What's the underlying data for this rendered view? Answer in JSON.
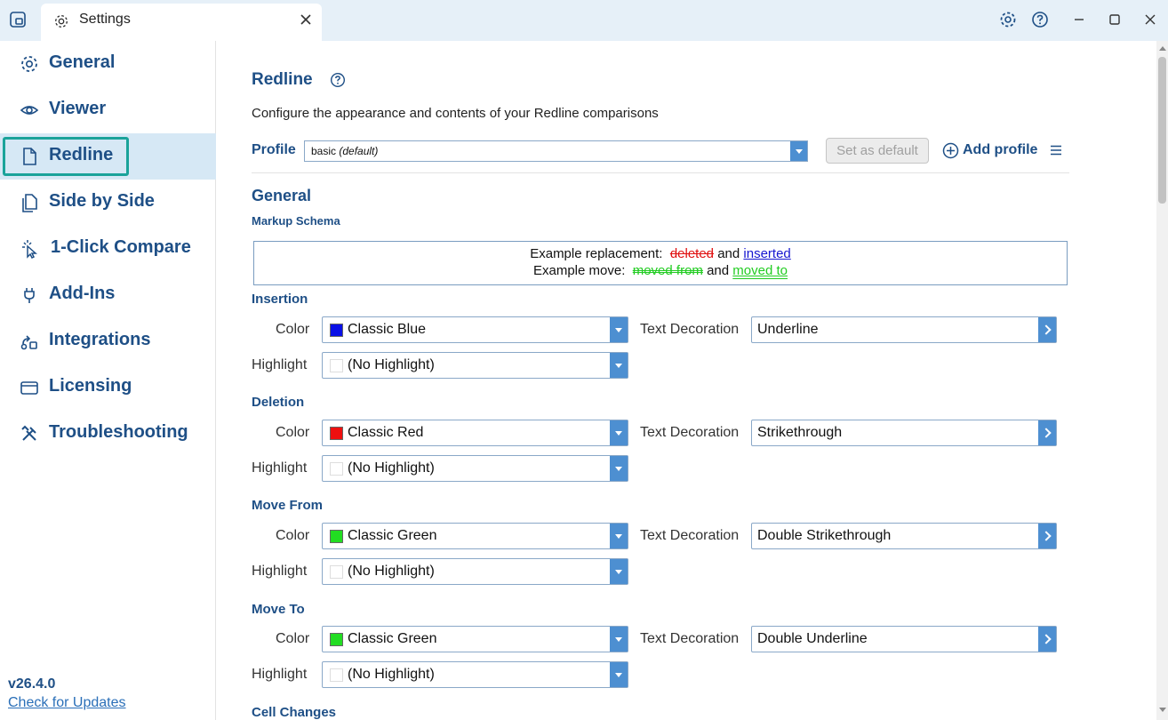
{
  "window": {
    "tab_title": "Settings",
    "controls": [
      "settings-icon",
      "help-icon",
      "minimize-icon",
      "maximize-icon",
      "close-icon"
    ]
  },
  "sidebar": {
    "items": [
      {
        "label": "General",
        "icon": "gear-icon"
      },
      {
        "label": "Viewer",
        "icon": "eye-icon"
      },
      {
        "label": "Redline",
        "icon": "document-icon",
        "active": true
      },
      {
        "label": "Side by Side",
        "icon": "documents-icon"
      },
      {
        "label": "1-Click Compare",
        "icon": "pointer-click-icon"
      },
      {
        "label": "Add-Ins",
        "icon": "plug-icon"
      },
      {
        "label": "Integrations",
        "icon": "integrations-icon"
      },
      {
        "label": "Licensing",
        "icon": "card-icon"
      },
      {
        "label": "Troubleshooting",
        "icon": "tools-icon"
      }
    ],
    "version": "v26.4.0",
    "check_updates": "Check for Updates"
  },
  "main": {
    "title": "Redline",
    "description": "Configure the appearance and contents of your Redline comparisons",
    "profile": {
      "label": "Profile",
      "value": "basic",
      "value_suffix": "(default)",
      "set_default": "Set as default",
      "add_profile": "Add profile"
    },
    "general_title": "General",
    "markup_schema": {
      "title": "Markup Schema",
      "replacement_prefix": "Example replacement:",
      "deleted": "deleted",
      "and1": "and",
      "inserted": "inserted",
      "move_prefix": "Example move:",
      "moved_from": "moved from",
      "and2": "and",
      "moved_to": "moved to"
    },
    "labels": {
      "color": "Color",
      "highlight": "Highlight",
      "text_decoration": "Text Decoration"
    },
    "groups": [
      {
        "title": "Insertion",
        "color": "Classic Blue",
        "swatch": "#0a10e6",
        "highlight": "(No Highlight)",
        "decoration": "Underline"
      },
      {
        "title": "Deletion",
        "color": "Classic Red",
        "swatch": "#ee1010",
        "highlight": "(No Highlight)",
        "decoration": "Strikethrough"
      },
      {
        "title": "Move From",
        "color": "Classic Green",
        "swatch": "#22dd22",
        "highlight": "(No Highlight)",
        "decoration": "Double Strikethrough"
      },
      {
        "title": "Move To",
        "color": "Classic Green",
        "swatch": "#22dd22",
        "highlight": "(No Highlight)",
        "decoration": "Double Underline"
      }
    ],
    "next_section": "Cell Changes"
  },
  "colors": {
    "accent": "#1e4f86",
    "active_bg": "#d6e8f5",
    "active_outline": "#1aa39a",
    "dropdown": "#4d8fd1"
  }
}
